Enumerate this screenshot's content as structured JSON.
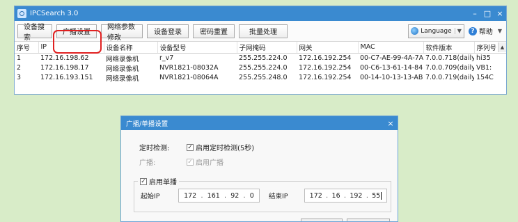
{
  "app": {
    "title": "IPCSearch 3.0",
    "controls": {
      "minimize": "–",
      "maximize": "□",
      "close": "×"
    }
  },
  "toolbar": {
    "buttons": [
      "设备搜索",
      "广播设置",
      "网络参数修改",
      "设备登录",
      "密码重置",
      "批量处理"
    ],
    "language_label": "Language",
    "help_label": "帮助",
    "help_icon_char": "?"
  },
  "table": {
    "headers": [
      "序号",
      "IP",
      "设备名称",
      "设备型号",
      "子网掩码",
      "网关",
      "MAC",
      "软件版本",
      "序列号"
    ],
    "rows": [
      [
        "1",
        "172.16.198.62",
        "网络录像机",
        "r_v7",
        "255.255.224.0",
        "172.16.192.254",
        "00-C7-AE-99-4A-7A",
        "7.0.0.718(daily)",
        "hi35"
      ],
      [
        "2",
        "172.16.198.17",
        "网络录像机",
        "NVR1821-08032A",
        "255.255.224.0",
        "172.16.192.254",
        "00-C6-13-61-14-84",
        "7.0.0.709(daily)",
        "VB1:"
      ],
      [
        "3",
        "172.16.193.151",
        "网络录像机",
        "NVR1821-08064A",
        "255.255.248.0",
        "172.16.192.254",
        "00-14-10-13-13-AB",
        "7.0.0.719(daily)",
        "154C"
      ]
    ]
  },
  "dialog": {
    "title": "广播/单播设置",
    "close": "×",
    "timer_label": "定时检测:",
    "timer_checkbox": "启用定时检测(5秒)",
    "broadcast_label": "广播:",
    "broadcast_checkbox": "启用广播",
    "unicast_checkbox": "启用单播",
    "check_mark": "✓",
    "start_ip_label": "起始IP",
    "end_ip_label": "结束IP",
    "start_ip": [
      "172",
      "161",
      "92",
      "0"
    ],
    "end_ip": [
      "172",
      "16",
      "192",
      "55"
    ]
  },
  "colors": {
    "background": "#d8ecc8",
    "titlebar": "#3a8ad0",
    "highlight": "#e02020"
  }
}
